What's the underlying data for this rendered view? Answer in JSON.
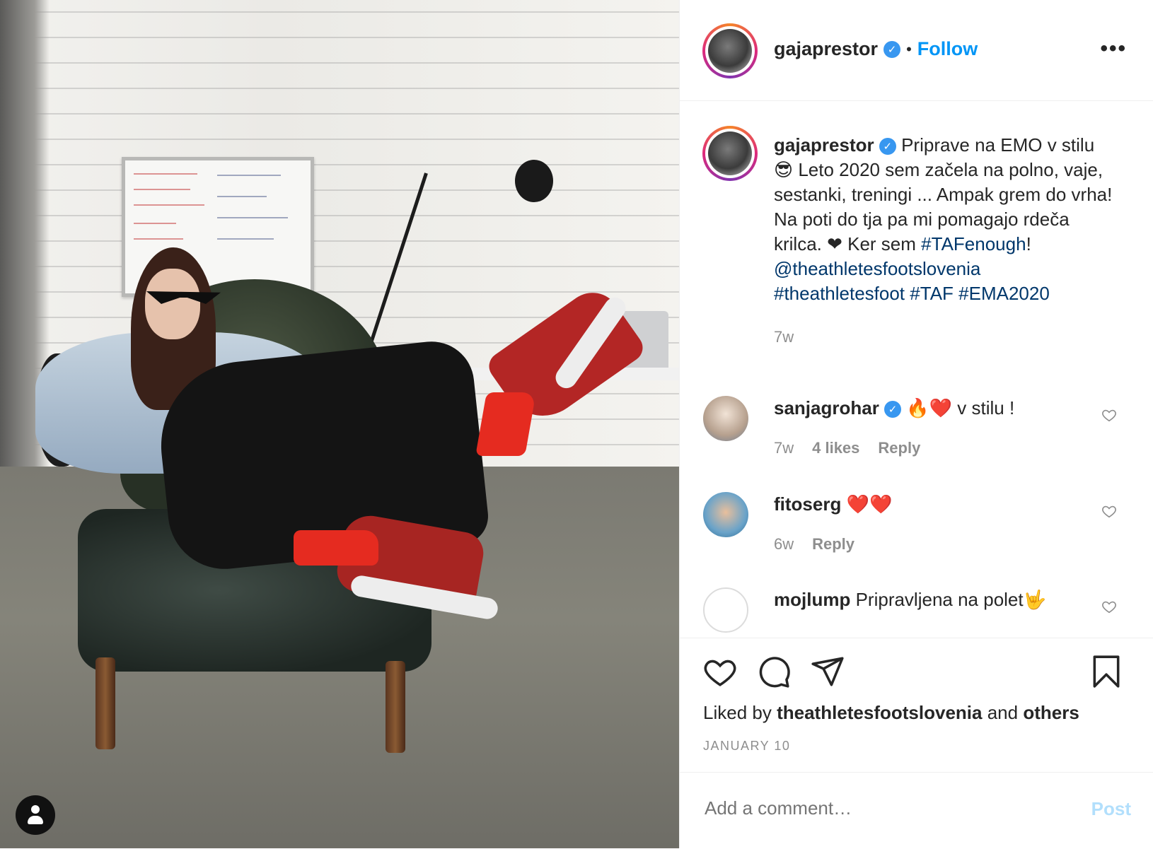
{
  "header": {
    "username": "gajaprestor",
    "verified_mark": "✓",
    "separator": "•",
    "follow_label": "Follow",
    "more_label": "•••"
  },
  "caption": {
    "username": "gajaprestor",
    "text_1": "Priprave na EMO v stilu😎 Leto 2020 sem začela na polno, vaje, sestanki, treningi ... Ampak grem do vrha! Na poti do tja pa mi pomagajo rdeča krilca. ❤ Ker sem ",
    "hashtag_1": "#TAFenough",
    "text_2": "!",
    "mention": "@theathletesfootslovenia",
    "hashtag_2": "#theathletesfoot",
    "hashtag_3": "#TAF",
    "hashtag_4": "#EMA2020",
    "time": "7w"
  },
  "comments": [
    {
      "username": "sanjagrohar",
      "verified": true,
      "text": "🔥❤️ v stilu !",
      "time": "7w",
      "likes": "4 likes",
      "reply": "Reply"
    },
    {
      "username": "fitoserg",
      "verified": false,
      "text": "❤️❤️",
      "time": "6w",
      "likes": "",
      "reply": "Reply"
    },
    {
      "username": "mojlump",
      "verified": false,
      "text": "Pripravljena na polet🤟",
      "time": "",
      "likes": "",
      "reply": ""
    }
  ],
  "actions": {
    "icons": [
      "heart-icon",
      "comment-icon",
      "share-icon",
      "bookmark-icon"
    ],
    "liked_by_prefix": "Liked by",
    "liked_by_user": "theathletesfootslovenia",
    "liked_by_and": "and",
    "liked_by_others": "others",
    "date": "JANUARY 10"
  },
  "add_comment": {
    "placeholder": "Add a comment…",
    "post_label": "Post"
  },
  "colors": {
    "accent": "#0095f6",
    "verified": "#3897f0",
    "link": "#00376b",
    "muted": "#8e8e8e",
    "post_disabled": "#b2dffc"
  }
}
